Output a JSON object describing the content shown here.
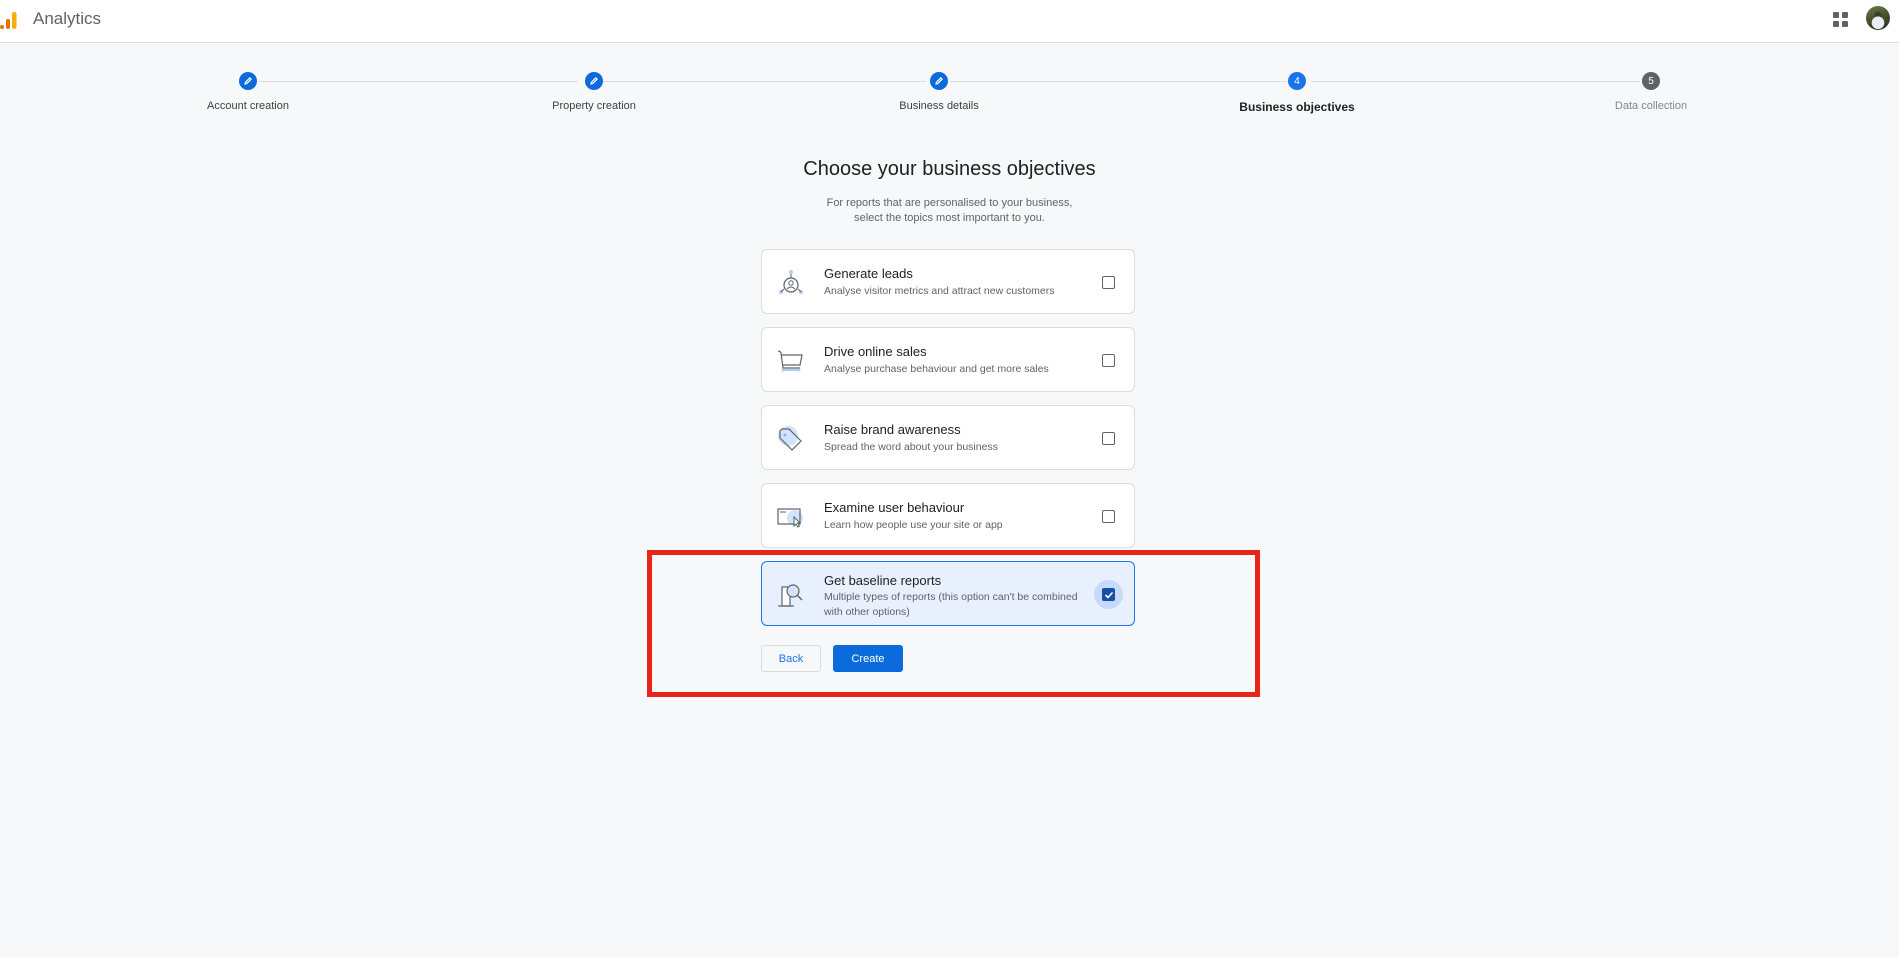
{
  "topbar": {
    "app_title": "Analytics",
    "icons": [
      "analytics-logo",
      "apps-grid-icon",
      "account-avatar"
    ]
  },
  "stepper": {
    "steps": [
      {
        "label": "Account creation",
        "state": "done",
        "marker": "pencil-icon"
      },
      {
        "label": "Property creation",
        "state": "done",
        "marker": "pencil-icon"
      },
      {
        "label": "Business details",
        "state": "done",
        "marker": "pencil-icon"
      },
      {
        "label": "Business objectives",
        "state": "active",
        "marker": "4"
      },
      {
        "label": "Data collection",
        "state": "pending",
        "marker": "5"
      }
    ]
  },
  "main": {
    "heading": "Choose your business objectives",
    "subheading_line1": "For reports that are personalised to your business,",
    "subheading_line2": "select the topics most important to you.",
    "options": [
      {
        "title": "Generate leads",
        "description": "Analyse visitor metrics and attract new customers",
        "icon": "leads-network-icon",
        "checked": false
      },
      {
        "title": "Drive online sales",
        "description": "Analyse purchase behaviour and get more sales",
        "icon": "shopping-cart-icon",
        "checked": false
      },
      {
        "title": "Raise brand awareness",
        "description": "Spread the word about your business",
        "icon": "price-tag-icon",
        "checked": false
      },
      {
        "title": "Examine user behaviour",
        "description": "Learn how people use your site or app",
        "icon": "screen-cursor-icon",
        "checked": false
      },
      {
        "title": "Get baseline reports",
        "description": "Multiple types of reports (this option can't be combined with other options)",
        "icon": "report-magnifier-icon",
        "checked": true
      }
    ],
    "back_label": "Back",
    "create_label": "Create"
  },
  "colors": {
    "accent": "#1a73e8",
    "checked": "#174ea6",
    "selected_bg": "#e8f0fe",
    "highlight": "#e8251b"
  }
}
